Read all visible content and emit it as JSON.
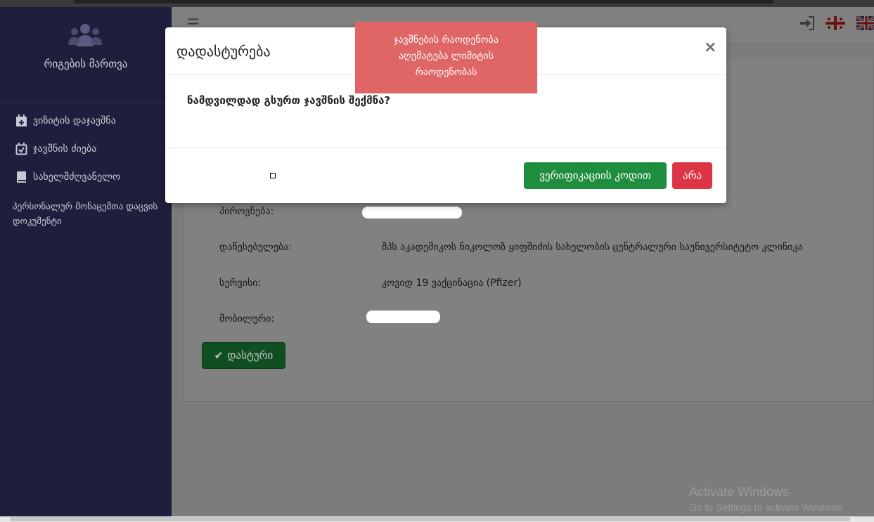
{
  "sidebar": {
    "brand": "რიგების მართვა",
    "items": [
      {
        "label": "ვიზიტის დაჯავშნა",
        "icon": "calendar-plus-icon"
      },
      {
        "label": "ჯავშნის ძიება",
        "icon": "calendar-check-icon"
      },
      {
        "label": "სახელმძღვანელო",
        "icon": "book-icon"
      }
    ],
    "plain_link": "პერსონალურ მონაცემთა დაცვის დოკუმენტი"
  },
  "topbar": {
    "menu_icon": "hamburger-icon",
    "login_icon": "sign-in-icon",
    "languages": [
      "georgian-flag-icon",
      "uk-flag-icon"
    ]
  },
  "details": {
    "person_label": "პიროვნება:",
    "institution_label": "დაწესებულება:",
    "institution_value": "შპს აკადემიკოს ნიკოლოზ ყიფშიძის სახელობის ცენტრალური საუნივერსიტეტო კლინიკა",
    "service_label": "სერვისი:",
    "service_value": "კოვიდ 19 ვაქცინაცია (Pfizer)",
    "mobile_label": "მობილური:",
    "confirm_button": "დასტური"
  },
  "modal": {
    "title": "დადასტურება",
    "close": "×",
    "question": "ნამდვილდად გსურთ ჯავშნის შექმნა?",
    "verify_button": "ვერიფიკაციის კოდით",
    "no_button": "არა"
  },
  "toast": {
    "line1": "ჯავშნების რაოდენობა",
    "line2": "აღემატება ლიმიტის",
    "line3": "რაოდენობას"
  },
  "watermark": {
    "title": "Activate Windows",
    "subtitle": "Go to Settings to activate Windows."
  },
  "colors": {
    "sidebar_bg": "#1e1f3d",
    "success": "#1e8e3e",
    "danger": "#dc3545",
    "toast": "#e06565"
  }
}
